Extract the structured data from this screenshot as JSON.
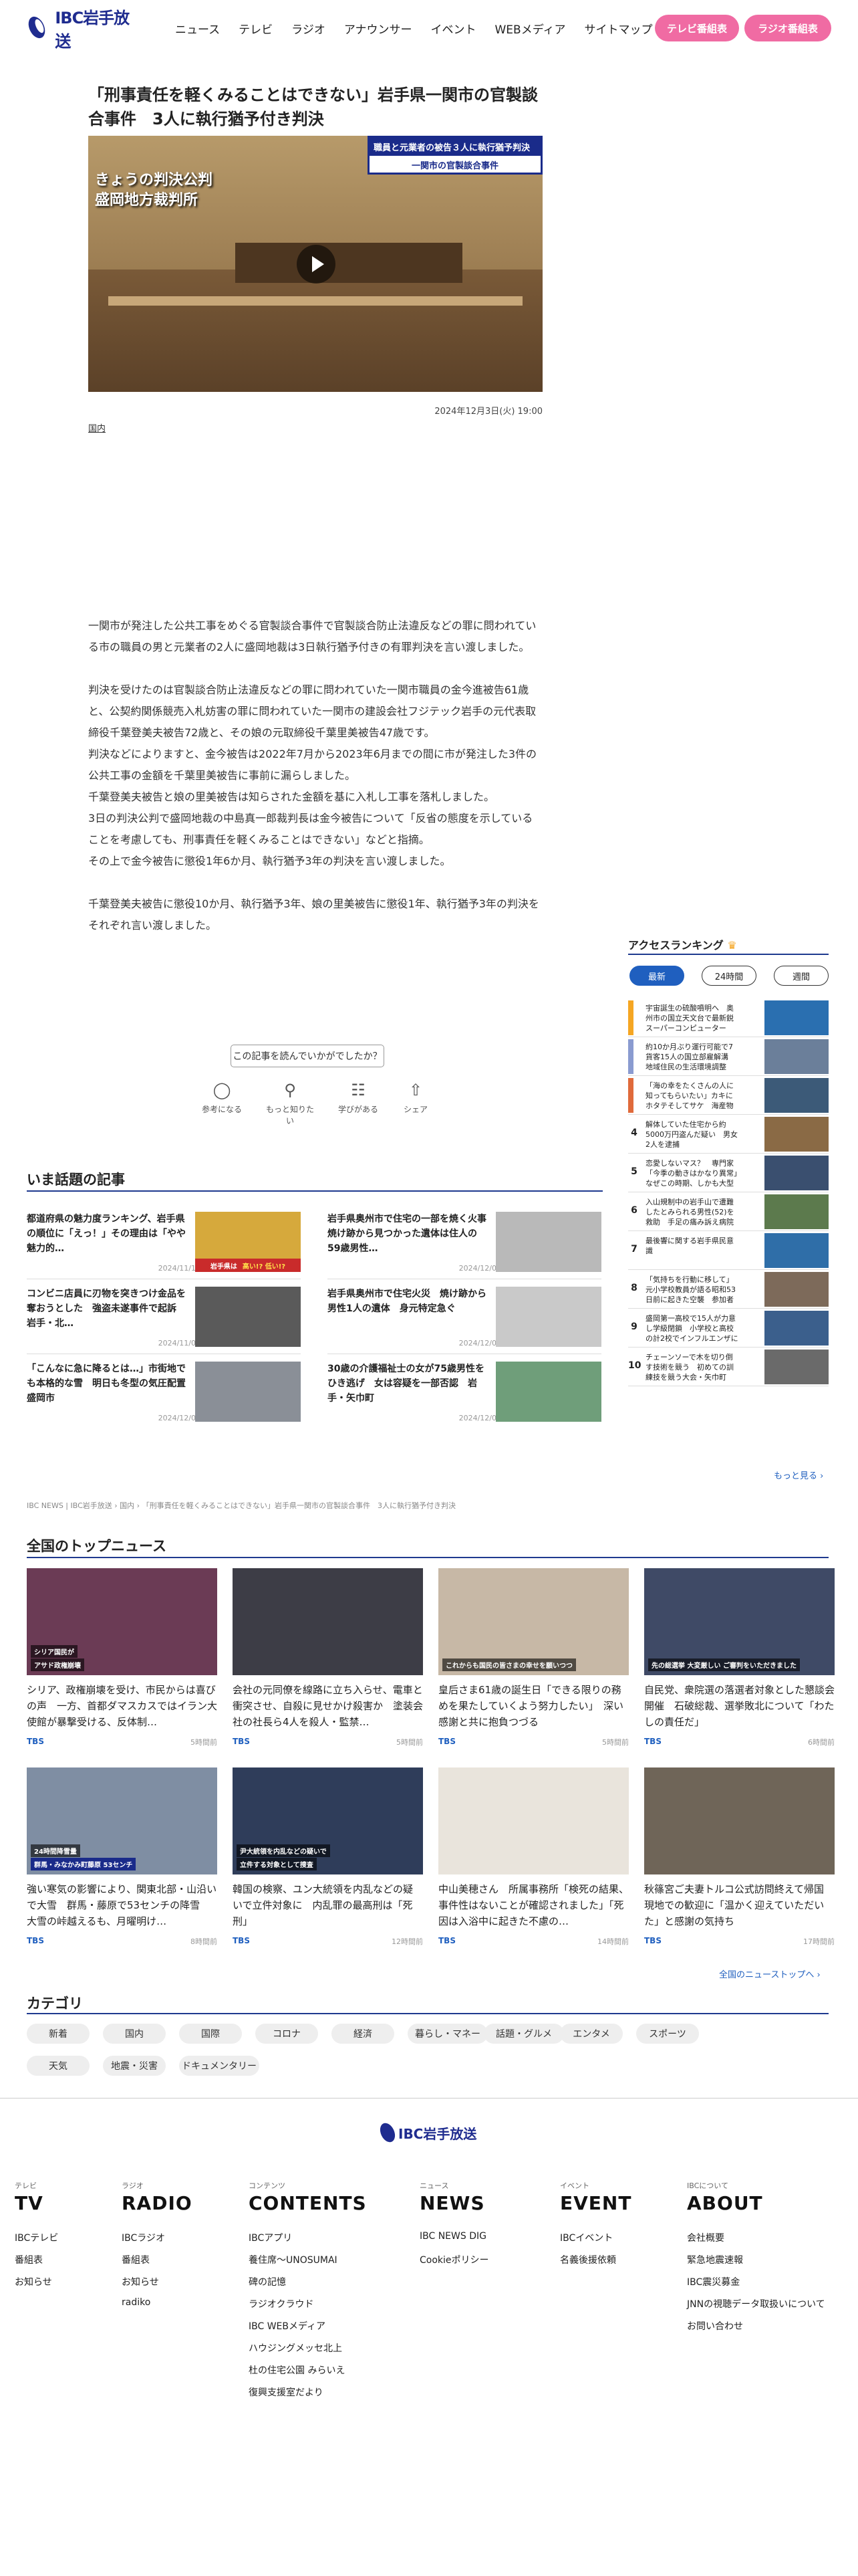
{
  "header": {
    "logo_text": "IBC岩手放送",
    "nav": [
      "ニュース",
      "テレビ",
      "ラジオ",
      "アナウンサー",
      "イベント",
      "WEBメディア",
      "サイトマップ"
    ],
    "tv_schedule": "テレビ番組表",
    "radio_schedule": "ラジオ番組表"
  },
  "article": {
    "title": "「刑事責任を軽くみることはできない」岩手県一関市の官製談合事件　3人に執行猶予付き判決",
    "video_caption1": "きょうの判決公判",
    "video_caption2": "盛岡地方裁判所",
    "video_tag1": "職員と元業者の被告３人に執行猶予判決",
    "video_tag2": "一関市の官製談合事件",
    "date": "2024年12月3日(火) 19:00",
    "category": "国内",
    "paragraphs": [
      "一関市が発注した公共工事をめぐる官製談合事件で官製談合防止法違反などの罪に問われている市の職員の男と元業者の2人に盛岡地裁は3日執行猶予付きの有罪判決を言い渡しました。",
      "判決を受けたのは官製談合防止法違反などの罪に問われていた一関市職員の金今進被告61歳と、公契約関係競売入札妨害の罪に問われていた一関市の建設会社フジテック岩手の元代表取締役千葉登美夫被告72歳と、その娘の元取締役千葉里美被告47歳です。",
      "判決などによりますと、金今被告は2022年7月から2023年6月までの間に市が発注した3件の公共工事の金額を千葉里美被告に事前に漏らしました。",
      "千葉登美夫被告と娘の里美被告は知らされた金額を基に入札し工事を落札しました。",
      "3日の判決公判で盛岡地裁の中島真一郎裁判長は金今被告について「反省の態度を示していることを考慮しても、刑事責任を軽くみることはできない」などと指摘。",
      "その上で金今被告に懲役1年6か月、執行猶予3年の判決を言い渡しました。",
      "千葉登美夫被告に懲役10か月、執行猶予3年、娘の里美被告に懲役1年、執行猶予3年の判決をそれぞれ言い渡しました。"
    ],
    "feedback_q": "この記事を読んでいかがでしたか？",
    "feedback": [
      "参考になる",
      "もっと知りたい",
      "学びがある",
      "シェア"
    ]
  },
  "trending": {
    "title": "いま話題の記事",
    "items": [
      {
        "headline": "都道府県の魅力度ランキング、岩手県の順位に「えっ！」その理由は「やや魅力的…",
        "time": "2024/11/11"
      },
      {
        "headline": "岩手県奥州市で住宅の一部を焼く火事　焼け跡から見つかった遺体は住人の59歳男性…",
        "time": "2024/12/03"
      },
      {
        "headline": "コンビニ店員に刃物を突きつけ金品を奪おうとした　強盗未遂事件で起訴　岩手・北…",
        "time": "2024/11/02"
      },
      {
        "headline": "岩手県奥州市で住宅火災　焼け跡から男性1人の遺体　身元特定急ぐ",
        "time": "2024/12/03"
      },
      {
        "headline": "「こんなに急に降るとは…」市街地でも本格的な雪　明日も冬型の気圧配置　盛岡市",
        "time": "2024/12/06"
      },
      {
        "headline": "30歳の介護福祉士の女が75歳男性をひき逃げ　女は容疑を一部否認　岩手・矢巾町",
        "time": "2024/12/03"
      }
    ],
    "thumb_text": [
      "岩手県は",
      "高い!? 低い!?"
    ]
  },
  "breadcrumb": "IBC NEWS | IBC岩手放送 › 国内 › 「刑事責任を軽くみることはできない」岩手県一関市の官製談合事件　3人に執行猶予付き判決",
  "ranking": {
    "title": "アクセスランキング",
    "tabs": [
      "最新",
      "24時間",
      "週間"
    ],
    "items": [
      "宇宙誕生の硫酸噴明へ　奥州市の国立天文台で最新鋭スーパーコンピューター「アテル…",
      "約10か月ぶり運行可能で7貨客15人の国立部雇解溝　地域住民の生活環境調整「排権」が最…",
      "「海の幸をたくさんの人に知ってもらいたい」カキにホタテそしてサケ　海産物集めた…",
      "解体していた住宅から約5000万円盗んだ疑い　男女2人を逮捕",
      "恋愛しないマス？　専門家「今季の動きはかなり異常」なぜこの時期、しかも大型シ…",
      "入山規制中の岩手山で遭難したとみられる男性(52)を救助　手足の痛み訴え病院へ",
      "最後響に関する岩手県民意識",
      "「気持ちを行動に移して」　元小学校教員が語る昭和53日前に起きた空襲　参加者が痛…",
      "盛岡第一高校で15人が力意し学級閉鎖　小学校と高校の計2校でインフルエンザによ…",
      "チェーンソーで木を切り倒す技術を競う　初めての訓練技を競う大会・矢巾町"
    ],
    "more": "もっと見る"
  },
  "topnews": {
    "title": "全国のトップニュース",
    "items": [
      {
        "headline": "シリア、政権崩壊を受け、市民からは喜びの声　一方、首都ダマスカスではイラン大使館が暴撃受ける、反体制…",
        "src": "TBS",
        "time": "5時間前"
      },
      {
        "headline": "会社の元同僚を線路に立ち入らせ、電車と衝突させ、自殺に見せかけ殺害か　塗装会社の社長ら4人を殺人・監禁…",
        "src": "TBS",
        "time": "5時間前"
      },
      {
        "headline": "皇后さま61歳の誕生日「できる限りの務めを果たしていくよう努力したい」　深い感謝と共に抱負つづる",
        "src": "TBS",
        "time": "5時間前"
      },
      {
        "headline": "自民党、衆院選の落選者対象とした懇談会開催　石破総裁、選挙敗北について「わたしの責任だ」",
        "src": "TBS",
        "time": "6時間前"
      },
      {
        "headline": "強い寒気の影響により、関東北部・山沿いで大雪　群馬・藤原で53センチの降雪　大雪の峠越えるも、月曜明け…",
        "src": "TBS",
        "time": "8時間前"
      },
      {
        "headline": "韓国の検察、ユン大統領を内乱などの疑いで立件対象に　内乱罪の最高刑は「死刑」",
        "src": "TBS",
        "time": "12時間前"
      },
      {
        "headline": "中山美穂さん　所属事務所「検死の結果、事件性はないことが確認されました」「死因は入浴中に起きた不慮の…",
        "src": "TBS",
        "time": "14時間前"
      },
      {
        "headline": "秋篠宮ご夫妻トルコ公式訪問終えて帰国　現地での歓迎に「温かく迎えていただいた」と感謝の気持ち",
        "src": "TBS",
        "time": "17時間前"
      }
    ],
    "overlays": [
      "シリア国民が",
      "アサド政権崩壊",
      "これからも国民の皆さまの幸せを願いつつ",
      "先の総選挙 大変厳しい ご審判をいただきました",
      "24時間降雪量",
      "群馬・みなかみ町藤原 53センチ",
      "尹大統領を内乱などの疑いで",
      "立件する対象として捜査"
    ],
    "all_link": "全国のニューストップへ"
  },
  "categories": {
    "title": "カテゴリ",
    "items": [
      "新着",
      "国内",
      "国際",
      "コロナ",
      "経済",
      "暮らし・マネー",
      "話題・グルメ",
      "エンタメ",
      "スポーツ",
      "天気",
      "地震・災害",
      "ドキュメンタリー"
    ]
  },
  "footer": {
    "logo_text": "IBC岩手放送",
    "columns": [
      {
        "label": "テレビ",
        "big": "TV",
        "links": [
          "IBCテレビ",
          "番組表",
          "お知らせ"
        ]
      },
      {
        "label": "ラジオ",
        "big": "RADIO",
        "links": [
          "IBCラジオ",
          "番組表",
          "お知らせ",
          "radiko"
        ]
      },
      {
        "label": "コンテンツ",
        "big": "CONTENTS",
        "links": [
          "IBCアプリ",
          "養住席〜UNOSUMAI",
          "碑の記憶",
          "ラジオクラウド",
          "IBC WEBメディア",
          "ハウジングメッセ北上",
          "杜の住宅公園 みらいえ",
          "復興支援室だより"
        ]
      },
      {
        "label": "ニュース",
        "big": "NEWS",
        "links": [
          "IBC NEWS DIG",
          "Cookieポリシー"
        ]
      },
      {
        "label": "イベント",
        "big": "EVENT",
        "links": [
          "IBCイベント",
          "名義後援依頼"
        ]
      },
      {
        "label": "IBCについて",
        "big": "ABOUT",
        "links": [
          "会社概要",
          "緊急地震速報",
          "IBC震災募金",
          "JNNの視聴データ取扱いについて",
          "お問い合わせ"
        ]
      }
    ]
  },
  "colors": {
    "brand_navy": "#1f2c8f",
    "pink": "#f06ba3",
    "link_blue": "#1f5fbf",
    "rank_orange": "#f5a623"
  }
}
